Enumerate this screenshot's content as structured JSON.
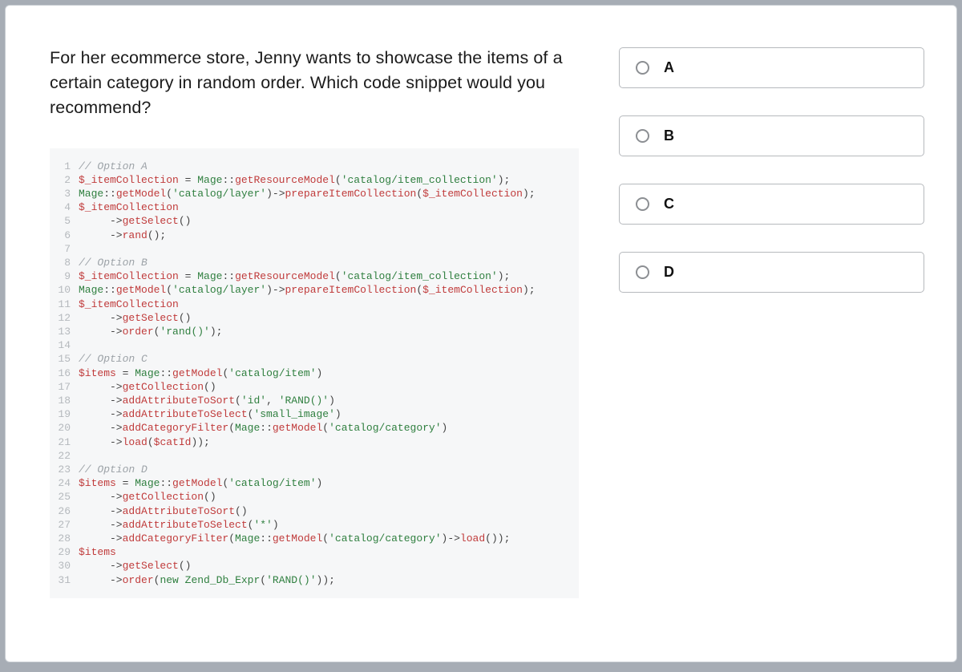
{
  "question": "For her ecommerce store, Jenny wants to showcase the items of a certain category in random order. Which code snippet would you recommend?",
  "options": [
    {
      "label": "A"
    },
    {
      "label": "B"
    },
    {
      "label": "C"
    },
    {
      "label": "D"
    }
  ],
  "code": {
    "lines": [
      {
        "n": 1,
        "t": [
          {
            "c": "c-comment",
            "v": "// Option A"
          }
        ]
      },
      {
        "n": 2,
        "t": [
          {
            "c": "c-var",
            "v": "$_itemCollection"
          },
          {
            "c": "c-op",
            "v": " = "
          },
          {
            "c": "c-class",
            "v": "Mage"
          },
          {
            "c": "c-punct",
            "v": "::"
          },
          {
            "c": "c-call",
            "v": "getResourceModel"
          },
          {
            "c": "c-punct",
            "v": "("
          },
          {
            "c": "c-str",
            "v": "'catalog/item_collection'"
          },
          {
            "c": "c-punct",
            "v": ");"
          }
        ]
      },
      {
        "n": 3,
        "t": [
          {
            "c": "c-class",
            "v": "Mage"
          },
          {
            "c": "c-punct",
            "v": "::"
          },
          {
            "c": "c-call",
            "v": "getModel"
          },
          {
            "c": "c-punct",
            "v": "("
          },
          {
            "c": "c-str",
            "v": "'catalog/layer'"
          },
          {
            "c": "c-punct",
            "v": ")->"
          },
          {
            "c": "c-call",
            "v": "prepareItemCollection"
          },
          {
            "c": "c-punct",
            "v": "("
          },
          {
            "c": "c-var",
            "v": "$_itemCollection"
          },
          {
            "c": "c-punct",
            "v": ");"
          }
        ]
      },
      {
        "n": 4,
        "t": [
          {
            "c": "c-var",
            "v": "$_itemCollection"
          }
        ]
      },
      {
        "n": 5,
        "t": [
          {
            "c": "c-punct",
            "v": "     ->"
          },
          {
            "c": "c-call",
            "v": "getSelect"
          },
          {
            "c": "c-punct",
            "v": "()"
          }
        ]
      },
      {
        "n": 6,
        "t": [
          {
            "c": "c-punct",
            "v": "     ->"
          },
          {
            "c": "c-call",
            "v": "rand"
          },
          {
            "c": "c-punct",
            "v": "();"
          }
        ]
      },
      {
        "n": 7,
        "t": [
          {
            "c": "",
            "v": ""
          }
        ]
      },
      {
        "n": 8,
        "t": [
          {
            "c": "c-comment",
            "v": "// Option B"
          }
        ]
      },
      {
        "n": 9,
        "t": [
          {
            "c": "c-var",
            "v": "$_itemCollection"
          },
          {
            "c": "c-op",
            "v": " = "
          },
          {
            "c": "c-class",
            "v": "Mage"
          },
          {
            "c": "c-punct",
            "v": "::"
          },
          {
            "c": "c-call",
            "v": "getResourceModel"
          },
          {
            "c": "c-punct",
            "v": "("
          },
          {
            "c": "c-str",
            "v": "'catalog/item_collection'"
          },
          {
            "c": "c-punct",
            "v": ");"
          }
        ]
      },
      {
        "n": 10,
        "t": [
          {
            "c": "c-class",
            "v": "Mage"
          },
          {
            "c": "c-punct",
            "v": "::"
          },
          {
            "c": "c-call",
            "v": "getModel"
          },
          {
            "c": "c-punct",
            "v": "("
          },
          {
            "c": "c-str",
            "v": "'catalog/layer'"
          },
          {
            "c": "c-punct",
            "v": ")->"
          },
          {
            "c": "c-call",
            "v": "prepareItemCollection"
          },
          {
            "c": "c-punct",
            "v": "("
          },
          {
            "c": "c-var",
            "v": "$_itemCollection"
          },
          {
            "c": "c-punct",
            "v": ");"
          }
        ]
      },
      {
        "n": 11,
        "t": [
          {
            "c": "c-var",
            "v": "$_itemCollection"
          }
        ]
      },
      {
        "n": 12,
        "t": [
          {
            "c": "c-punct",
            "v": "     ->"
          },
          {
            "c": "c-call",
            "v": "getSelect"
          },
          {
            "c": "c-punct",
            "v": "()"
          }
        ]
      },
      {
        "n": 13,
        "t": [
          {
            "c": "c-punct",
            "v": "     ->"
          },
          {
            "c": "c-call",
            "v": "order"
          },
          {
            "c": "c-punct",
            "v": "("
          },
          {
            "c": "c-str",
            "v": "'rand()'"
          },
          {
            "c": "c-punct",
            "v": ");"
          }
        ]
      },
      {
        "n": 14,
        "t": [
          {
            "c": "",
            "v": ""
          }
        ]
      },
      {
        "n": 15,
        "t": [
          {
            "c": "c-comment",
            "v": "// Option C"
          }
        ]
      },
      {
        "n": 16,
        "t": [
          {
            "c": "c-var",
            "v": "$items"
          },
          {
            "c": "c-op",
            "v": " = "
          },
          {
            "c": "c-class",
            "v": "Mage"
          },
          {
            "c": "c-punct",
            "v": "::"
          },
          {
            "c": "c-call",
            "v": "getModel"
          },
          {
            "c": "c-punct",
            "v": "("
          },
          {
            "c": "c-str",
            "v": "'catalog/item'"
          },
          {
            "c": "c-punct",
            "v": ")"
          }
        ]
      },
      {
        "n": 17,
        "t": [
          {
            "c": "c-punct",
            "v": "     ->"
          },
          {
            "c": "c-call",
            "v": "getCollection"
          },
          {
            "c": "c-punct",
            "v": "()"
          }
        ]
      },
      {
        "n": 18,
        "t": [
          {
            "c": "c-punct",
            "v": "     ->"
          },
          {
            "c": "c-call",
            "v": "addAttributeToSort"
          },
          {
            "c": "c-punct",
            "v": "("
          },
          {
            "c": "c-str",
            "v": "'id'"
          },
          {
            "c": "c-punct",
            "v": ", "
          },
          {
            "c": "c-str",
            "v": "'RAND()'"
          },
          {
            "c": "c-punct",
            "v": ")"
          }
        ]
      },
      {
        "n": 19,
        "t": [
          {
            "c": "c-punct",
            "v": "     ->"
          },
          {
            "c": "c-call",
            "v": "addAttributeToSelect"
          },
          {
            "c": "c-punct",
            "v": "("
          },
          {
            "c": "c-str",
            "v": "'small_image'"
          },
          {
            "c": "c-punct",
            "v": ")"
          }
        ]
      },
      {
        "n": 20,
        "t": [
          {
            "c": "c-punct",
            "v": "     ->"
          },
          {
            "c": "c-call",
            "v": "addCategoryFilter"
          },
          {
            "c": "c-punct",
            "v": "("
          },
          {
            "c": "c-class",
            "v": "Mage"
          },
          {
            "c": "c-punct",
            "v": "::"
          },
          {
            "c": "c-call",
            "v": "getModel"
          },
          {
            "c": "c-punct",
            "v": "("
          },
          {
            "c": "c-str",
            "v": "'catalog/category'"
          },
          {
            "c": "c-punct",
            "v": ")"
          }
        ]
      },
      {
        "n": 21,
        "t": [
          {
            "c": "c-punct",
            "v": "     ->"
          },
          {
            "c": "c-call",
            "v": "load"
          },
          {
            "c": "c-punct",
            "v": "("
          },
          {
            "c": "c-var",
            "v": "$catId"
          },
          {
            "c": "c-punct",
            "v": "));"
          }
        ]
      },
      {
        "n": 22,
        "t": [
          {
            "c": "",
            "v": ""
          }
        ]
      },
      {
        "n": 23,
        "t": [
          {
            "c": "c-comment",
            "v": "// Option D"
          }
        ]
      },
      {
        "n": 24,
        "t": [
          {
            "c": "c-var",
            "v": "$items"
          },
          {
            "c": "c-op",
            "v": " = "
          },
          {
            "c": "c-class",
            "v": "Mage"
          },
          {
            "c": "c-punct",
            "v": "::"
          },
          {
            "c": "c-call",
            "v": "getModel"
          },
          {
            "c": "c-punct",
            "v": "("
          },
          {
            "c": "c-str",
            "v": "'catalog/item'"
          },
          {
            "c": "c-punct",
            "v": ")"
          }
        ]
      },
      {
        "n": 25,
        "t": [
          {
            "c": "c-punct",
            "v": "     ->"
          },
          {
            "c": "c-call",
            "v": "getCollection"
          },
          {
            "c": "c-punct",
            "v": "()"
          }
        ]
      },
      {
        "n": 26,
        "t": [
          {
            "c": "c-punct",
            "v": "     ->"
          },
          {
            "c": "c-call",
            "v": "addAttributeToSort"
          },
          {
            "c": "c-punct",
            "v": "()"
          }
        ]
      },
      {
        "n": 27,
        "t": [
          {
            "c": "c-punct",
            "v": "     ->"
          },
          {
            "c": "c-call",
            "v": "addAttributeToSelect"
          },
          {
            "c": "c-punct",
            "v": "("
          },
          {
            "c": "c-str",
            "v": "'*'"
          },
          {
            "c": "c-punct",
            "v": ")"
          }
        ]
      },
      {
        "n": 28,
        "t": [
          {
            "c": "c-punct",
            "v": "     ->"
          },
          {
            "c": "c-call",
            "v": "addCategoryFilter"
          },
          {
            "c": "c-punct",
            "v": "("
          },
          {
            "c": "c-class",
            "v": "Mage"
          },
          {
            "c": "c-punct",
            "v": "::"
          },
          {
            "c": "c-call",
            "v": "getModel"
          },
          {
            "c": "c-punct",
            "v": "("
          },
          {
            "c": "c-str",
            "v": "'catalog/category'"
          },
          {
            "c": "c-punct",
            "v": ")->"
          },
          {
            "c": "c-call",
            "v": "load"
          },
          {
            "c": "c-punct",
            "v": "());"
          }
        ]
      },
      {
        "n": 29,
        "t": [
          {
            "c": "c-var",
            "v": "$items"
          }
        ]
      },
      {
        "n": 30,
        "t": [
          {
            "c": "c-punct",
            "v": "     ->"
          },
          {
            "c": "c-call",
            "v": "getSelect"
          },
          {
            "c": "c-punct",
            "v": "()"
          }
        ]
      },
      {
        "n": 31,
        "t": [
          {
            "c": "c-punct",
            "v": "     ->"
          },
          {
            "c": "c-call",
            "v": "order"
          },
          {
            "c": "c-punct",
            "v": "("
          },
          {
            "c": "c-new",
            "v": "new"
          },
          {
            "c": "c-punct",
            "v": " "
          },
          {
            "c": "c-class",
            "v": "Zend_Db_Expr"
          },
          {
            "c": "c-punct",
            "v": "("
          },
          {
            "c": "c-str",
            "v": "'RAND()'"
          },
          {
            "c": "c-punct",
            "v": "));"
          }
        ]
      }
    ]
  }
}
